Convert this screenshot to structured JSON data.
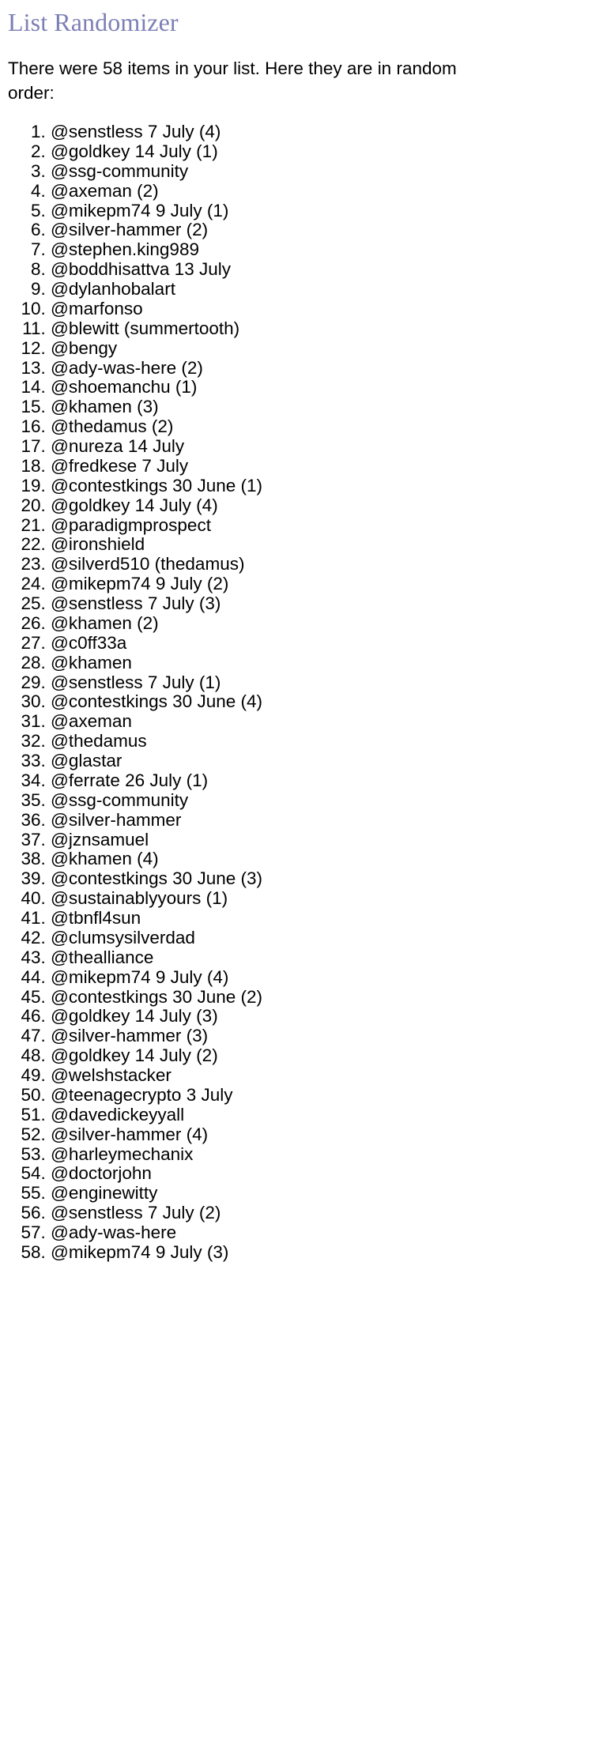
{
  "page": {
    "title": "List Randomizer",
    "intro": "There were 58 items in your list. Here they are in random order:",
    "item_count": 58,
    "title_color": "#7c7fb5",
    "text_color": "#000000",
    "background_color": "#ffffff"
  },
  "results": [
    "@senstless 7 July (4)",
    "@goldkey 14 July (1)",
    "@ssg-community",
    "@axeman (2)",
    "@mikepm74 9 July (1)",
    "@silver-hammer (2)",
    "@stephen.king989",
    "@boddhisattva 13 July",
    "@dylanhobalart",
    "@marfonso",
    "@blewitt (summertooth)",
    "@bengy",
    "@ady-was-here (2)",
    "@shoemanchu (1)",
    "@khamen (3)",
    "@thedamus (2)",
    "@nureza 14 July",
    "@fredkese 7 July",
    "@contestkings 30 June (1)",
    "@goldkey 14 July (4)",
    "@paradigmprospect",
    "@ironshield",
    "@silverd510 (thedamus)",
    "@mikepm74 9 July (2)",
    "@senstless 7 July (3)",
    "@khamen (2)",
    "@c0ff33a",
    "@khamen",
    "@senstless 7 July (1)",
    "@contestkings 30 June (4)",
    "@axeman",
    "@thedamus",
    "@glastar",
    "@ferrate 26 July (1)",
    "@ssg-community",
    "@silver-hammer",
    "@jznsamuel",
    "@khamen (4)",
    "@contestkings 30 June (3)",
    "@sustainablyyours (1)",
    "@tbnfl4sun",
    "@clumsysilverdad",
    "@thealliance",
    "@mikepm74 9 July (4)",
    "@contestkings 30 June (2)",
    "@goldkey 14 July (3)",
    "@silver-hammer (3)",
    "@goldkey 14 July (2)",
    "@welshstacker",
    "@teenagecrypto 3 July",
    "@davedickeyyall",
    "@silver-hammer (4)",
    "@harleymechanix",
    "@doctorjohn",
    "@enginewitty",
    "@senstless 7 July (2)",
    "@ady-was-here",
    "@mikepm74 9 July (3)"
  ]
}
